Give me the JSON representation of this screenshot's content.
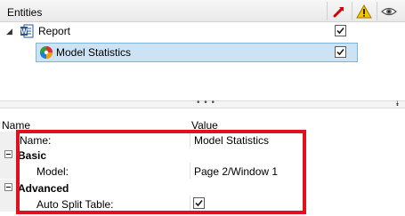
{
  "entities_panel": {
    "title": "Entities",
    "header_icons": [
      "pin-red-icon",
      "warning-icon",
      "eye-icon"
    ],
    "tree": [
      {
        "label": "Report",
        "icon": "word-document-icon",
        "expanded": true,
        "checked": true
      },
      {
        "label": "Model Statistics",
        "icon": "model-statistics-icon",
        "selected": true,
        "checked": true
      }
    ]
  },
  "splitter": {
    "grip": "• • •"
  },
  "property_grid": {
    "columns": {
      "name": "Name",
      "value": "Value"
    },
    "name_row": {
      "label": "Name:",
      "value": "Model Statistics"
    },
    "categories": [
      {
        "label": "Basic",
        "properties": [
          {
            "label": "Model:",
            "value": "Page 2/Window 1"
          }
        ]
      },
      {
        "label": "Advanced",
        "properties": [
          {
            "label": "Auto Split Table:",
            "value_checked": true
          }
        ]
      }
    ]
  },
  "colors": {
    "highlight": "#e0101e",
    "selection": "#cbe3f5",
    "selection_border": "#7fb4dc"
  }
}
